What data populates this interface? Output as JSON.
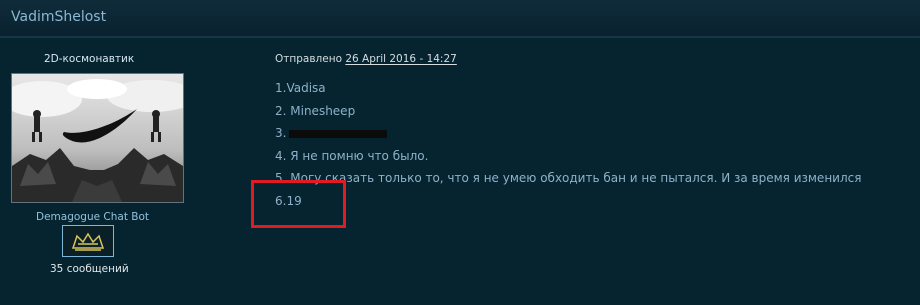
{
  "header": {
    "username": "VadimShelost"
  },
  "user": {
    "rank": "2D-космонавтик",
    "avatar_icon": "nike-swoosh-robots-avatar",
    "bot_name": "Demagogue Chat Bot",
    "badge_icon": "pixel-badge-icon",
    "post_count": "35 сообщений"
  },
  "post": {
    "posted_prefix": "Отправлено",
    "posted_date": "26 April 2016 - 14:27",
    "lines": [
      "1.Vadisa",
      "2. Minesheep",
      "3.",
      "4. Я не помню что было.",
      "5. Могу сказать только то, что я не умею обходить бан и не пытался. И за время изменился",
      "6.19"
    ]
  },
  "colors": {
    "background": "#062330",
    "link_text": "#8db2c8",
    "highlight": "#e01b24"
  }
}
